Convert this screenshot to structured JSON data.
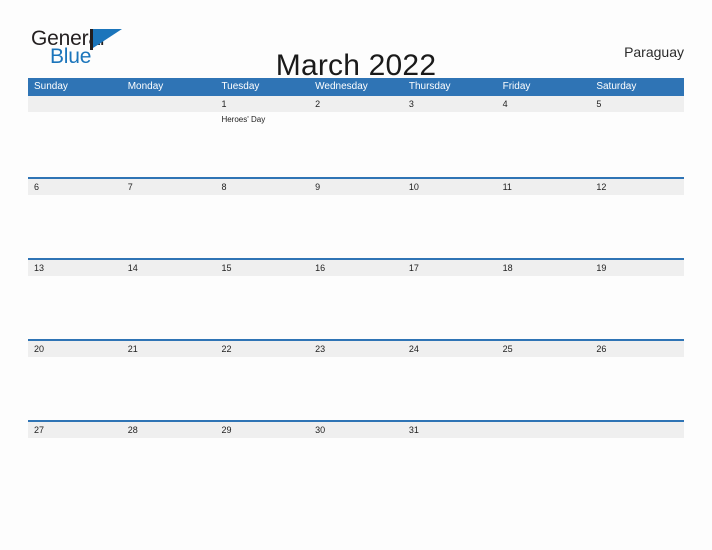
{
  "brand": {
    "name_part1": "General",
    "name_part2": "Blue",
    "flag_icon": "flag-triangle-icon",
    "color_dark": "#231f20",
    "color_blue": "#1b75bb"
  },
  "header": {
    "title": "March 2022",
    "country": "Paraguay"
  },
  "theme": {
    "header_blue": "#2f74b5",
    "date_band_gray": "#efefef",
    "page_background": "#fdfdfd",
    "text_color": "#222222"
  },
  "calendar": {
    "month": "March",
    "year": "2022",
    "weekdays": [
      "Sunday",
      "Monday",
      "Tuesday",
      "Wednesday",
      "Thursday",
      "Friday",
      "Saturday"
    ],
    "weeks": [
      [
        {
          "date": "",
          "events": []
        },
        {
          "date": "",
          "events": []
        },
        {
          "date": "1",
          "events": [
            "Heroes' Day"
          ]
        },
        {
          "date": "2",
          "events": []
        },
        {
          "date": "3",
          "events": []
        },
        {
          "date": "4",
          "events": []
        },
        {
          "date": "5",
          "events": []
        }
      ],
      [
        {
          "date": "6",
          "events": []
        },
        {
          "date": "7",
          "events": []
        },
        {
          "date": "8",
          "events": []
        },
        {
          "date": "9",
          "events": []
        },
        {
          "date": "10",
          "events": []
        },
        {
          "date": "11",
          "events": []
        },
        {
          "date": "12",
          "events": []
        }
      ],
      [
        {
          "date": "13",
          "events": []
        },
        {
          "date": "14",
          "events": []
        },
        {
          "date": "15",
          "events": []
        },
        {
          "date": "16",
          "events": []
        },
        {
          "date": "17",
          "events": []
        },
        {
          "date": "18",
          "events": []
        },
        {
          "date": "19",
          "events": []
        }
      ],
      [
        {
          "date": "20",
          "events": []
        },
        {
          "date": "21",
          "events": []
        },
        {
          "date": "22",
          "events": []
        },
        {
          "date": "23",
          "events": []
        },
        {
          "date": "24",
          "events": []
        },
        {
          "date": "25",
          "events": []
        },
        {
          "date": "26",
          "events": []
        }
      ],
      [
        {
          "date": "27",
          "events": []
        },
        {
          "date": "28",
          "events": []
        },
        {
          "date": "29",
          "events": []
        },
        {
          "date": "30",
          "events": []
        },
        {
          "date": "31",
          "events": []
        },
        {
          "date": "",
          "events": []
        },
        {
          "date": "",
          "events": []
        }
      ]
    ]
  }
}
